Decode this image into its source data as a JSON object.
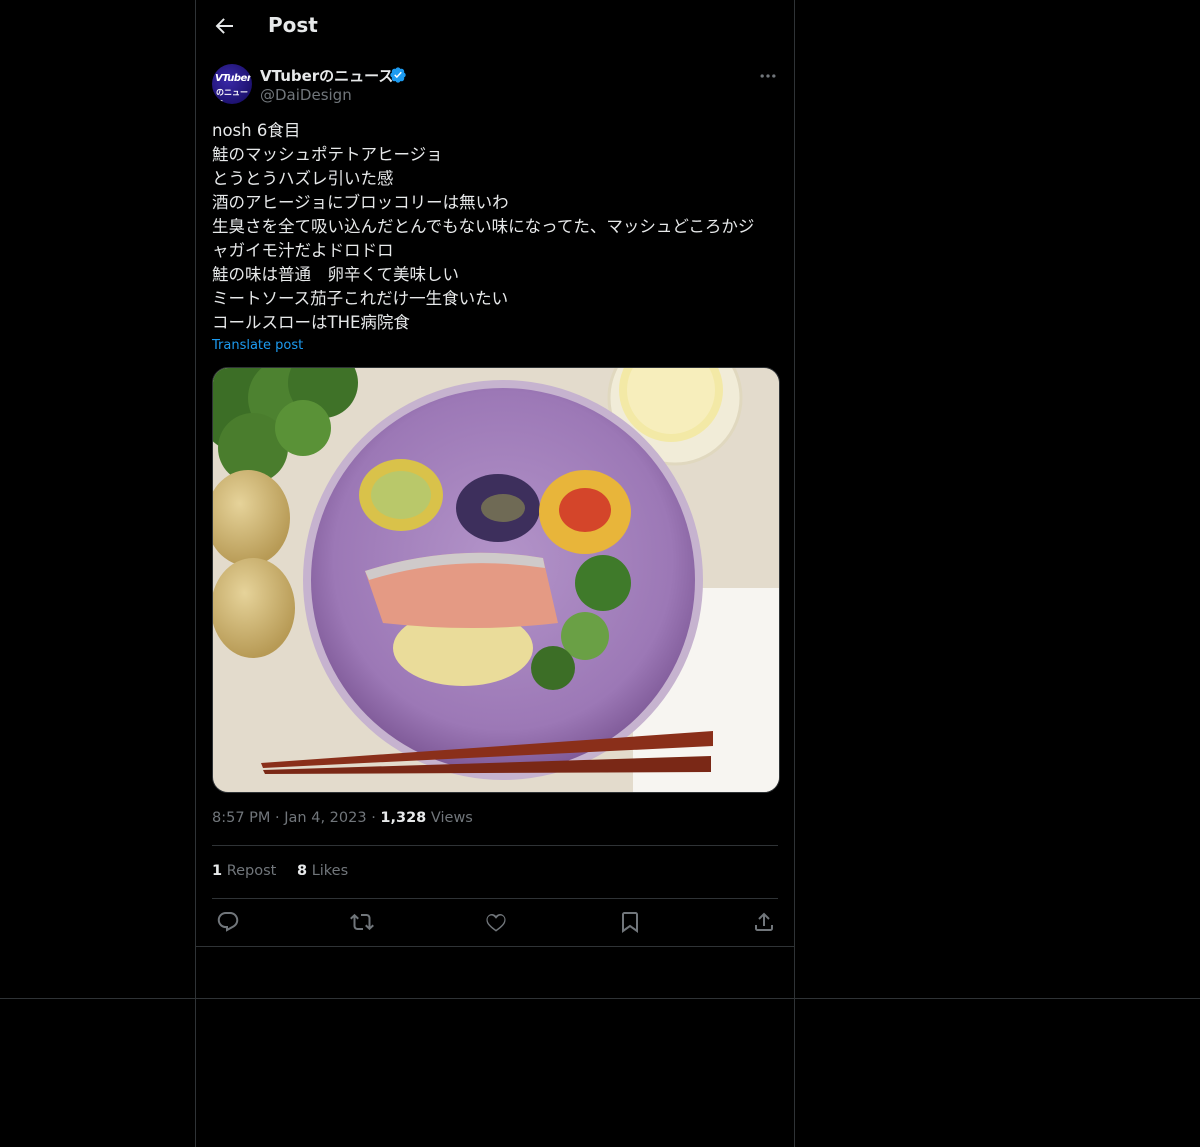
{
  "header": {
    "title": "Post",
    "back_icon": "arrow-left-icon"
  },
  "author": {
    "name": "VTuberのニュース",
    "handle": "@DaiDesign",
    "avatar_text_top": "VTuber",
    "avatar_text_bottom": "のニュース",
    "verified_color": "#1d9bf0"
  },
  "post": {
    "lines": [
      "nosh 6食目",
      "鮭のマッシュポテトアヒージョ",
      "とうとうハズレ引いた感",
      "酒のアヒージョにブロッコリーは無いわ",
      "生臭さを全て吸い込んだとんでもない味になってた、マッシュどころかジ",
      "ャガイモ汁だよドロドロ",
      "鮭の味は普通　卵辛くて美味しい",
      "ミートソース茄子これだけ一生食いたい",
      "コールスローはTHE病院食"
    ],
    "translate_label": "Translate post",
    "time": "8:57 PM",
    "date": "Jan 4, 2023",
    "separator": "·",
    "views_count": "1,328",
    "views_label": "Views"
  },
  "stats": {
    "reposts_count": "1",
    "reposts_label": "Repost",
    "likes_count": "8",
    "likes_label": "Likes"
  },
  "colors": {
    "background": "#000000",
    "text": "#e7e9ea",
    "muted": "#71767b",
    "accent": "#1d9bf0",
    "border": "#2f3336"
  }
}
